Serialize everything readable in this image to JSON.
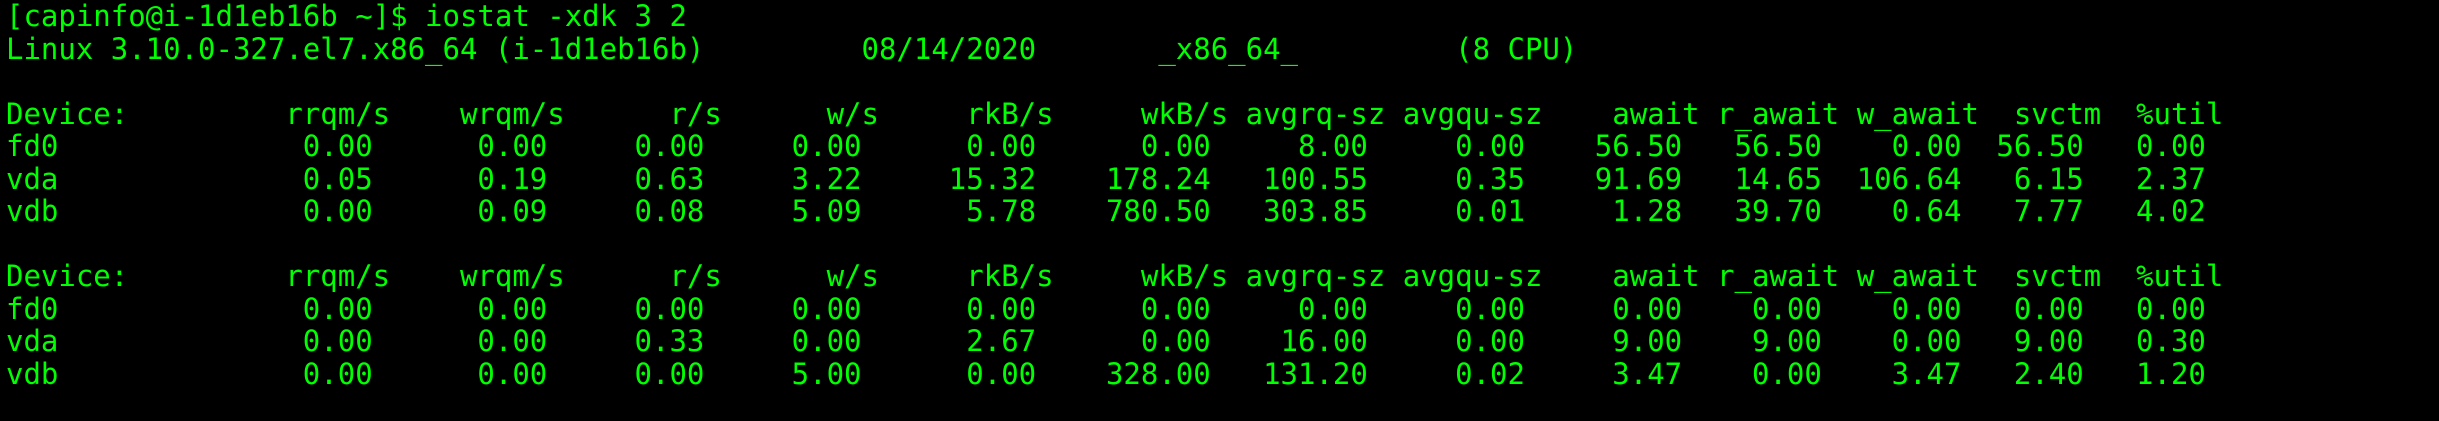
{
  "terminal": {
    "prompt": "[capinfo@i-1d1eb16b ~]$ ",
    "command": "iostat -xdk 3 2",
    "sysinfo": "Linux 3.10.0-327.el7.x86_64 (i-1d1eb16b)         08/14/2020       _x86_64_         (8 CPU)",
    "report1": {
      "header": "Device:         rrqm/s    wrqm/s      r/s      w/s     rkB/s     wkB/s avgrq-sz avgqu-sz    await r_await w_await  svctm  %util",
      "rows": [
        "fd0              0.00      0.00     0.00     0.00      0.00      0.00     8.00     0.00    56.50   56.50    0.00  56.50   0.00",
        "vda              0.05      0.19     0.63     3.22     15.32    178.24   100.55     0.35    91.69   14.65  106.64   6.15   2.37",
        "vdb              0.00      0.09     0.08     5.09      5.78    780.50   303.85     0.01     1.28   39.70    0.64   7.77   4.02"
      ]
    },
    "report2": {
      "header": "Device:         rrqm/s    wrqm/s      r/s      w/s     rkB/s     wkB/s avgrq-sz avgqu-sz    await r_await w_await  svctm  %util",
      "rows": [
        "fd0              0.00      0.00     0.00     0.00      0.00      0.00     0.00     0.00     0.00    0.00    0.00   0.00   0.00",
        "vda              0.00      0.00     0.33     0.00      2.67      0.00    16.00     0.00     9.00    9.00    0.00   9.00   0.30",
        "vdb              0.00      0.00     0.00     5.00      0.00    328.00   131.20     0.02     3.47    0.00    3.47   2.40   1.20"
      ]
    }
  },
  "colors": {
    "background": "#000000",
    "foreground": "#00ff00"
  }
}
